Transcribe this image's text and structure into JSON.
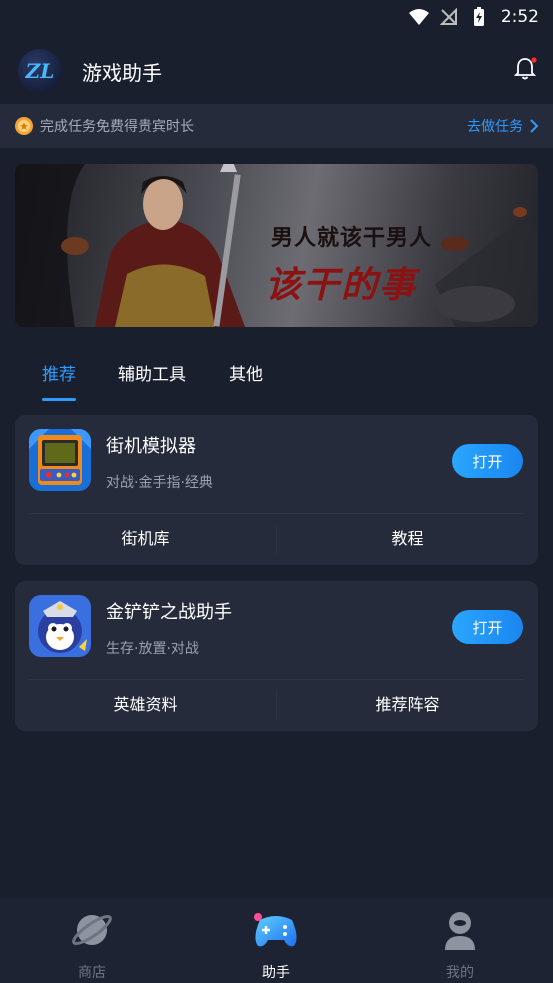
{
  "status_bar": {
    "time": "2:52"
  },
  "header": {
    "logo_text": "ZL",
    "title": "游戏助手"
  },
  "task_bar": {
    "text": "完成任务免费得贵宾时长",
    "action": "去做任务"
  },
  "banner": {
    "line1": "男人就该干男人",
    "line2": "该干的事"
  },
  "tabs": [
    {
      "label": "推荐",
      "active": true
    },
    {
      "label": "辅助工具",
      "active": false
    },
    {
      "label": "其他",
      "active": false
    }
  ],
  "cards": [
    {
      "name": "街机模拟器",
      "tags": "对战·金手指·经典",
      "open_label": "打开",
      "links": [
        "街机库",
        "教程"
      ]
    },
    {
      "name": "金铲铲之战助手",
      "tags": "生存·放置·对战",
      "open_label": "打开",
      "links": [
        "英雄资料",
        "推荐阵容"
      ]
    }
  ],
  "bottom_nav": [
    {
      "label": "商店",
      "icon": "planet-icon",
      "active": false
    },
    {
      "label": "助手",
      "icon": "gamepad-icon",
      "active": true
    },
    {
      "label": "我的",
      "icon": "profile-icon",
      "active": false
    }
  ],
  "colors": {
    "background": "#1a1f2e",
    "card": "#252b3b",
    "accent": "#2f9bff"
  }
}
